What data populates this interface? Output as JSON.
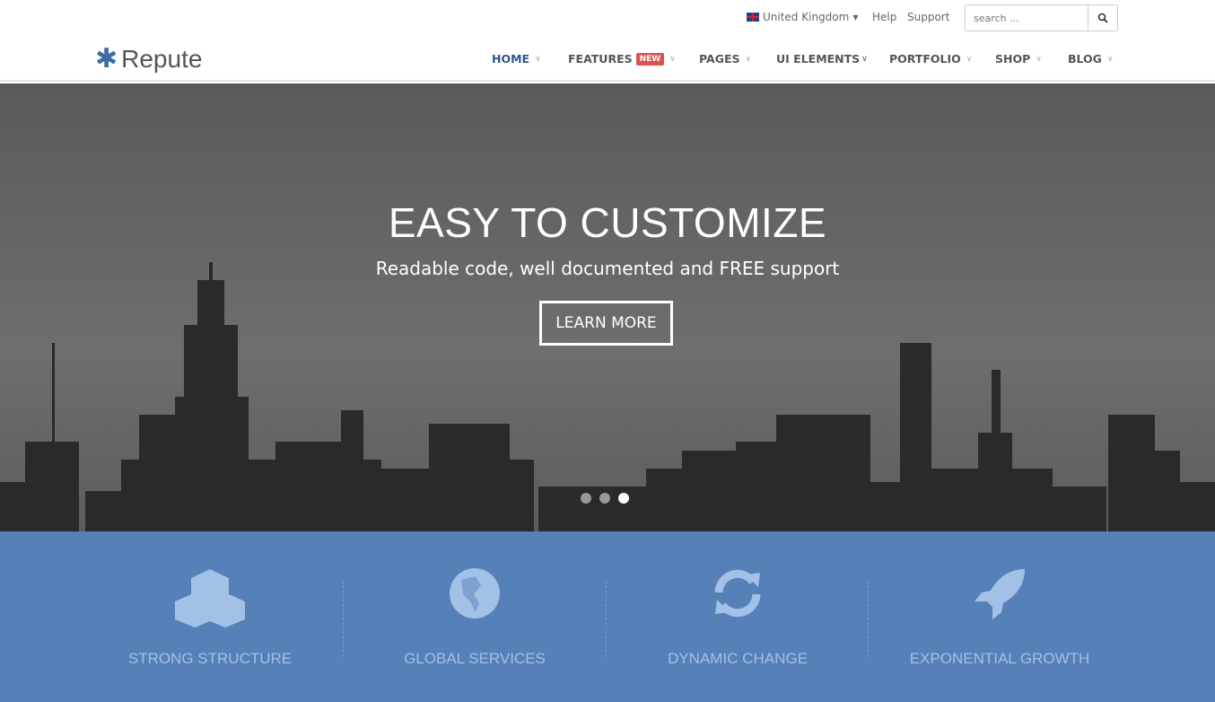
{
  "topbar": {
    "language": "United Kingdom",
    "help": "Help",
    "support": "Support",
    "search_placeholder": "search ..."
  },
  "brand": {
    "name": "Repute",
    "color": "#3e6da8"
  },
  "nav": [
    {
      "label": "HOME",
      "active": true
    },
    {
      "label": "FEATURES",
      "badge": "NEW"
    },
    {
      "label": "PAGES"
    },
    {
      "label": "UI ELEMENTS"
    },
    {
      "label": "PORTFOLIO"
    },
    {
      "label": "SHOP"
    },
    {
      "label": "BLOG"
    }
  ],
  "hero": {
    "title": "EASY TO CUSTOMIZE",
    "subtitle": "Readable code, well documented and FREE support",
    "cta": "LEARN MORE",
    "slides": 3,
    "active_slide": 3
  },
  "features": [
    {
      "label": "STRONG STRUCTURE",
      "icon": "cubes-icon"
    },
    {
      "label": "GLOBAL SERVICES",
      "icon": "globe-icon"
    },
    {
      "label": "DYNAMIC CHANGE",
      "icon": "refresh-icon"
    },
    {
      "label": "EXPONENTIAL GROWTH",
      "icon": "rocket-icon"
    }
  ],
  "colors": {
    "accent": "#5580b8",
    "icon": "#a3c0e6",
    "badge": "#d9534f"
  }
}
